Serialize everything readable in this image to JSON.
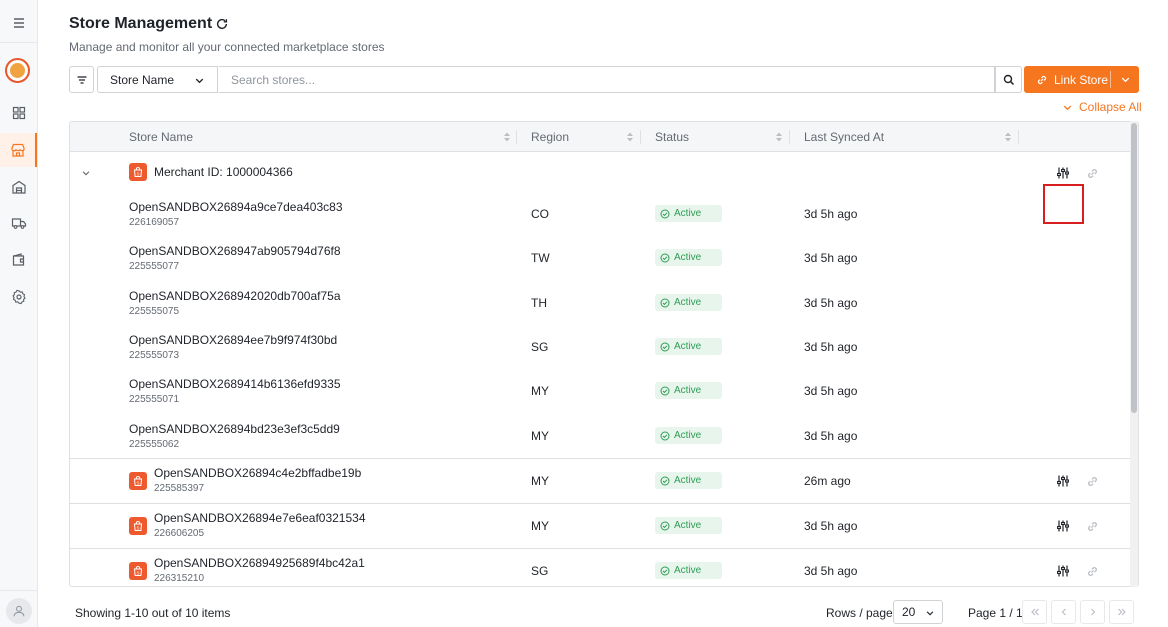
{
  "header": {
    "title": "Store Management",
    "subtitle": "Manage and monitor all your connected marketplace stores"
  },
  "filter": {
    "field_label": "Store Name",
    "search_placeholder": "Search stores...",
    "link_store_label": "Link Store",
    "collapse_all_label": "Collapse All"
  },
  "table": {
    "columns": [
      "Store Name",
      "Region",
      "Status",
      "Last Synced At"
    ],
    "merchant": {
      "label": "Merchant ID: 1000004366"
    },
    "child_rows": [
      {
        "name": "OpenSANDBOX26894a9ce7dea403c83",
        "id": "226169057",
        "region": "CO",
        "status": "Active",
        "synced": "3d 5h ago"
      },
      {
        "name": "OpenSANDBOX268947ab905794d76f8",
        "id": "225555077",
        "region": "TW",
        "status": "Active",
        "synced": "3d 5h ago"
      },
      {
        "name": "OpenSANDBOX268942020db700af75a",
        "id": "225555075",
        "region": "TH",
        "status": "Active",
        "synced": "3d 5h ago"
      },
      {
        "name": "OpenSANDBOX26894ee7b9f974f30bd",
        "id": "225555073",
        "region": "SG",
        "status": "Active",
        "synced": "3d 5h ago"
      },
      {
        "name": "OpenSANDBOX2689414b6136efd9335",
        "id": "225555071",
        "region": "MY",
        "status": "Active",
        "synced": "3d 5h ago"
      },
      {
        "name": "OpenSANDBOX26894bd23e3ef3c5dd9",
        "id": "225555062",
        "region": "MY",
        "status": "Active",
        "synced": "3d 5h ago"
      }
    ],
    "store_rows": [
      {
        "name": "OpenSANDBOX26894c4e2bffadbe19b",
        "id": "225585397",
        "region": "MY",
        "status": "Active",
        "synced": "26m ago"
      },
      {
        "name": "OpenSANDBOX26894e7e6eaf0321534",
        "id": "226606205",
        "region": "MY",
        "status": "Active",
        "synced": "3d 5h ago"
      },
      {
        "name": "OpenSANDBOX26894925689f4bc42a1",
        "id": "226315210",
        "region": "SG",
        "status": "Active",
        "synced": "3d 5h ago"
      }
    ]
  },
  "footer": {
    "showing": "Showing 1-10 out of 10 items",
    "rows_per_page_label": "Rows / page",
    "rows_per_page_value": "20",
    "page_label": "Page 1 / 1"
  },
  "colors": {
    "accent": "#f5761f",
    "active_badge_bg": "#e8f5ec",
    "active_badge_text": "#2e9e55",
    "shopee": "#ee5a2e",
    "highlight": "#d81e1e"
  },
  "icons": [
    "menu-icon",
    "dashboard-icon",
    "store-icon",
    "warehouse-icon",
    "truck-icon",
    "wallet-icon",
    "settings-icon",
    "user-icon",
    "refresh-icon",
    "filter-icon",
    "chevron-down-icon",
    "search-icon",
    "link-icon",
    "sliders-icon",
    "check-circle-icon",
    "shopee-bag-icon"
  ]
}
